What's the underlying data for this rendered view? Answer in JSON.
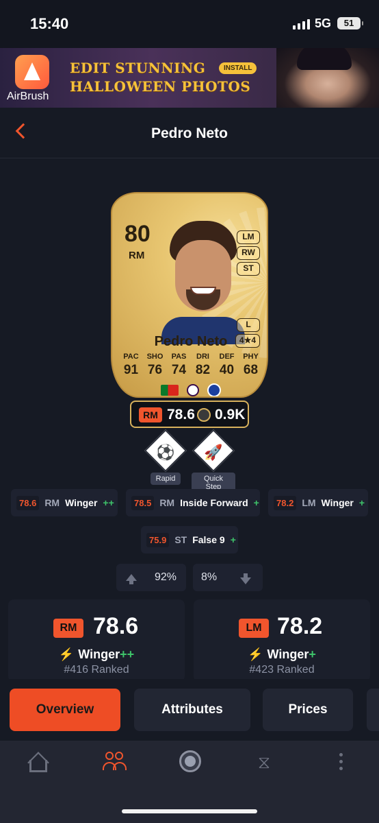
{
  "status_bar": {
    "time": "15:40",
    "network": "5G",
    "battery": "51"
  },
  "ad": {
    "brand": "AirBrush",
    "line1": "EDIT STUNNING",
    "line2": "HALLOWEEN PHOTOS",
    "install": "INSTALL"
  },
  "header": {
    "title": "Pedro Neto"
  },
  "card": {
    "rating": "80",
    "position": "RM",
    "alt_positions": [
      "LM",
      "RW",
      "ST"
    ],
    "foot": "L",
    "skill_weak": "4★4",
    "name": "Pedro Neto",
    "stats": [
      {
        "label": "PAC",
        "value": "91"
      },
      {
        "label": "SHO",
        "value": "76"
      },
      {
        "label": "PAS",
        "value": "74"
      },
      {
        "label": "DRI",
        "value": "82"
      },
      {
        "label": "DEF",
        "value": "40"
      },
      {
        "label": "PHY",
        "value": "68"
      }
    ]
  },
  "price_bar": {
    "position": "RM",
    "rating": "78.6",
    "price": "0.9K"
  },
  "playstyles": [
    {
      "label": "Rapid",
      "icon": "rapid-icon"
    },
    {
      "label": "Quick Step",
      "icon": "quick-step-icon"
    }
  ],
  "roles": [
    {
      "rating": "78.6",
      "position": "RM",
      "name": "Winger",
      "plus": "++"
    },
    {
      "rating": "78.5",
      "position": "RM",
      "name": "Inside Forward",
      "plus": "+"
    },
    {
      "rating": "78.2",
      "position": "LM",
      "name": "Winger",
      "plus": "+"
    },
    {
      "rating": "75.9",
      "position": "ST",
      "name": "False 9",
      "plus": "+"
    }
  ],
  "votes": {
    "up": "92%",
    "down": "8%"
  },
  "panels": [
    {
      "position": "RM",
      "rating": "78.6",
      "role": "Winger",
      "plus": "++",
      "rank": "#416 Ranked"
    },
    {
      "position": "LM",
      "rating": "78.2",
      "role": "Winger",
      "plus": "+",
      "rank": "#423 Ranked"
    }
  ],
  "tabs": [
    "Overview",
    "Attributes",
    "Prices"
  ],
  "colors": {
    "accent": "#f0552d",
    "background": "#161a24",
    "card_gold": "#e8c671",
    "positive": "#3ec46a"
  }
}
